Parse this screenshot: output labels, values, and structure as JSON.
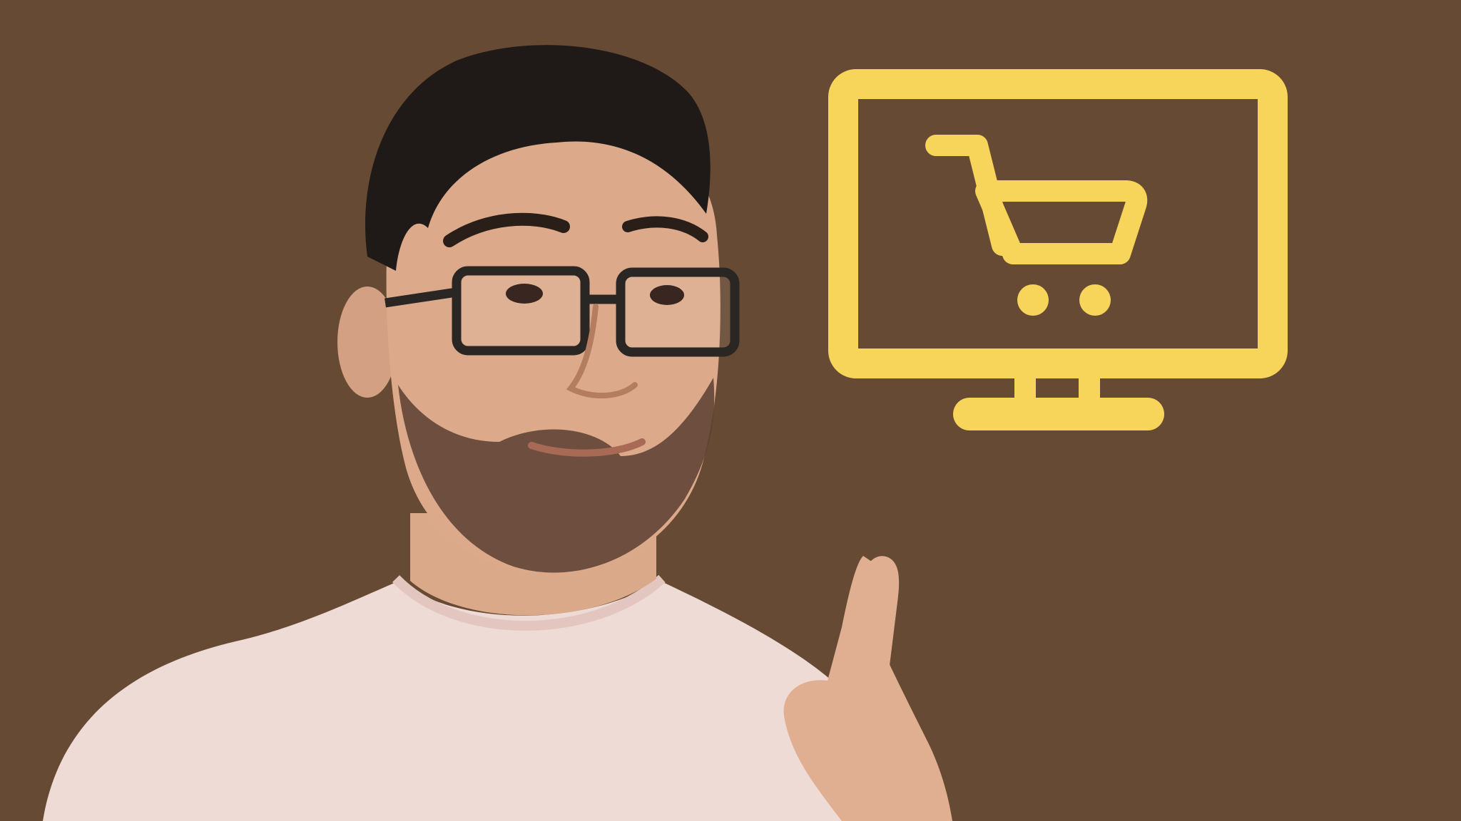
{
  "scene": {
    "background_color": "#674a33",
    "accent_color": "#f7d55b",
    "icon": "shopping-cart-monitor-icon",
    "subject": "person-pointing-up"
  }
}
